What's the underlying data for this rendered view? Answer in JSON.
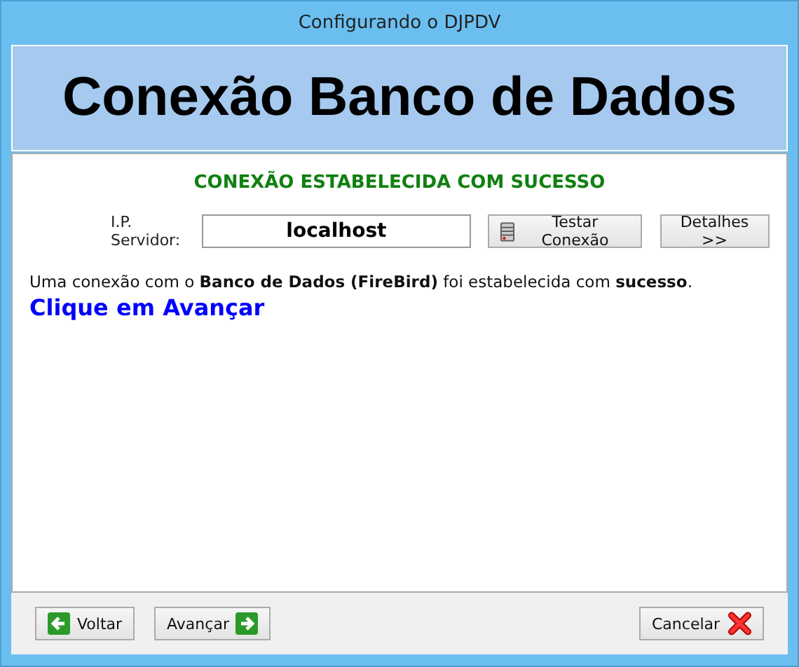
{
  "window": {
    "title": "Configurando o DJPDV"
  },
  "header": {
    "title": "Conexão Banco de Dados"
  },
  "status": "CONEXÃO ESTABELECIDA COM SUCESSO",
  "server": {
    "label": "I.P. Servidor:",
    "value": "localhost"
  },
  "test_button": "Testar Conexão",
  "details_button": "Detalhes >>",
  "message": "Uma conexão com o **Banco de Dados (FireBird)** foi estabelecida com **sucesso**.",
  "hint": "Clique em Avançar",
  "footer": {
    "back": "Voltar",
    "next": "Avançar",
    "cancel": "Cancelar"
  }
}
